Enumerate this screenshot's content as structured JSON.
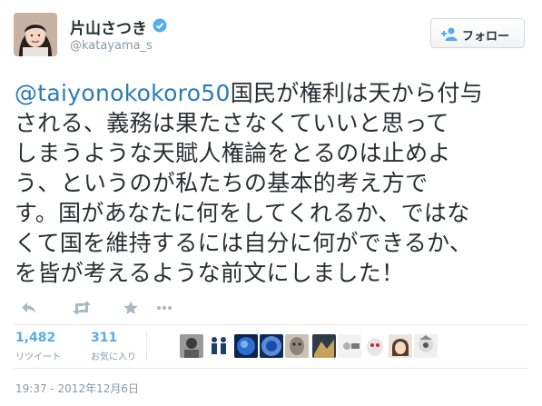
{
  "user": {
    "display_name": "片山さつき",
    "screen_name": "@katayama_s",
    "verified": true
  },
  "follow_button": {
    "label": "フォロー",
    "icon": "person-add-icon"
  },
  "tweet": {
    "mention": "@taiyonokokoro50",
    "lines": [
      "国民が権利は天から付与",
      "される、義務は果たさなくていいと思って",
      "しまうような天賦人権論をとるのは止めよ",
      "う、というのが私たちの基本的考え方で",
      "す。国があなたに何をしてくれるか、ではな",
      "くて国を維持するには自分に何ができるか、",
      "を皆が考えるような前文にしました！"
    ]
  },
  "actions": [
    {
      "name": "reply",
      "icon": "reply-icon"
    },
    {
      "name": "retweet",
      "icon": "retweet-icon"
    },
    {
      "name": "favorite",
      "icon": "star-icon"
    },
    {
      "name": "more",
      "icon": "more-dots-icon"
    }
  ],
  "stats": {
    "retweets": {
      "count": "1,482",
      "label": "リツイート"
    },
    "favorites": {
      "count": "311",
      "label": "お気に入り"
    }
  },
  "timestamp": "19:37 - 2012年12月6日",
  "colors": {
    "link": "#2b7bb9",
    "muted": "#8899a6",
    "verified": "#55acee",
    "text": "#292f33"
  }
}
